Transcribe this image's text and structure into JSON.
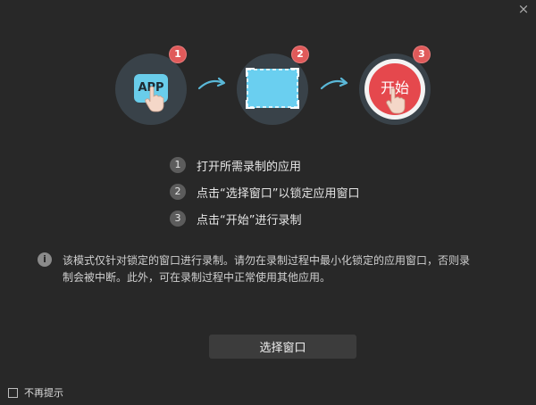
{
  "window": {
    "close_label": "×"
  },
  "illustration": {
    "step1": {
      "badge": "1",
      "app_label": "APP"
    },
    "step2": {
      "badge": "2"
    },
    "step3": {
      "badge": "3",
      "start_label": "开始"
    },
    "colors": {
      "badge": "#e05a5a",
      "accent": "#69cdeb",
      "start": "#e5484d",
      "circle": "#394249"
    }
  },
  "instructions": [
    {
      "num": "1",
      "text": "打开所需录制的应用"
    },
    {
      "num": "2",
      "text": "点击“选择窗口”以锁定应用窗口"
    },
    {
      "num": "3",
      "text": "点击“开始”进行录制"
    }
  ],
  "info": {
    "icon": "i",
    "line1": "该模式仅针对锁定的窗口进行录制。请勿在录制过程中最小化锁定的应用窗口，否则录",
    "line2": "制会被中断。此外，可在录制过程中正常使用其他应用。"
  },
  "actions": {
    "select_window_label": "选择窗口"
  },
  "footer": {
    "dont_show_label": "不再提示"
  }
}
